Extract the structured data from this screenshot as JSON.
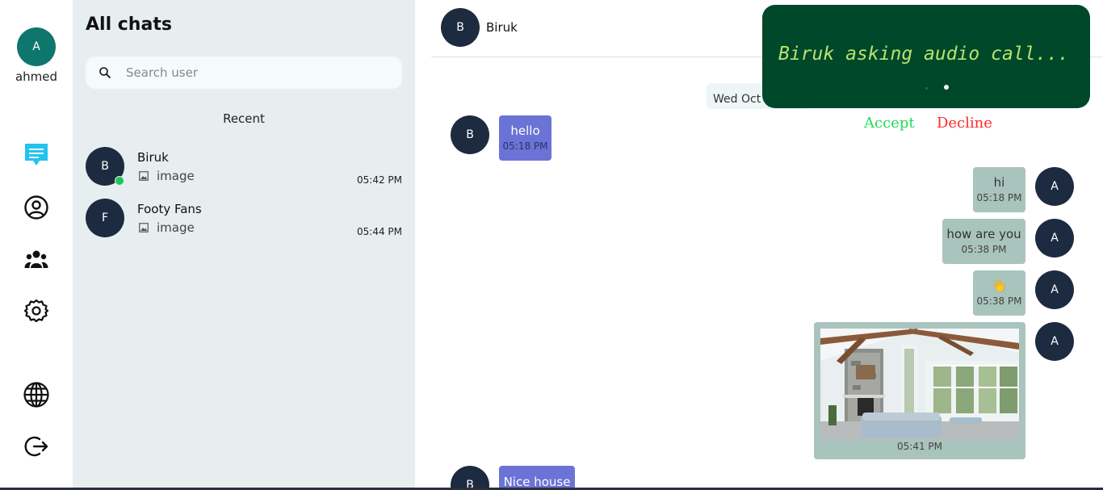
{
  "user": {
    "initial": "A",
    "name": "ahmed"
  },
  "rail": {
    "icons": [
      "chat-icon",
      "profile-icon",
      "groups-icon",
      "settings-icon",
      "language-icon",
      "logout-icon"
    ],
    "active_color": "#22c3ee"
  },
  "chat_list": {
    "title": "All chats",
    "search_placeholder": "Search user",
    "recent_label": "Recent",
    "items": [
      {
        "initial": "B",
        "name": "Biruk",
        "last_message": "image",
        "time": "05:42 PM",
        "online": true
      },
      {
        "initial": "F",
        "name": "Footy Fans",
        "last_message": "image",
        "time": "05:44 PM",
        "online": false
      }
    ]
  },
  "conversation": {
    "contact_initial": "B",
    "contact_name": "Biruk",
    "date_chip": "Wed Oct",
    "messages": [
      {
        "direction": "in",
        "initial": "B",
        "text": "hello",
        "time": "05:18 PM"
      },
      {
        "direction": "out",
        "initial": "A",
        "text": "hi",
        "time": "05:18 PM"
      },
      {
        "direction": "out",
        "initial": "A",
        "text": "how are you",
        "time": "05:38 PM"
      },
      {
        "direction": "out",
        "initial": "A",
        "text": "👋",
        "time": "05:38 PM"
      },
      {
        "direction": "out",
        "initial": "A",
        "type": "image",
        "time": "05:41 PM"
      },
      {
        "direction": "in",
        "initial": "B",
        "text": "Nice house"
      }
    ]
  },
  "call": {
    "text": "Biruk asking audio call...",
    "accept_label": "Accept",
    "decline_label": "Decline",
    "accept_color": "#22dd55",
    "decline_color": "#ff2a2a"
  }
}
